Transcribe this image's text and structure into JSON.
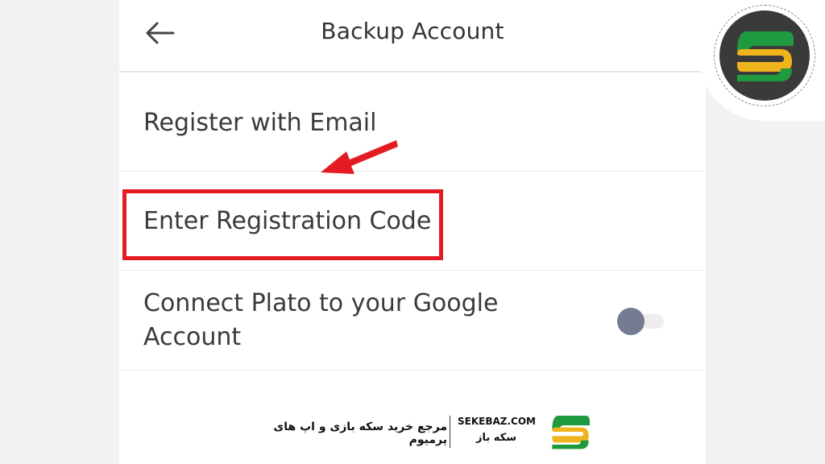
{
  "header": {
    "title": "Backup Account",
    "back_icon": "arrow-left-icon"
  },
  "options": [
    {
      "label": "Register with Email"
    },
    {
      "label": "Enter Registration Code"
    },
    {
      "label": "Connect Plato to your Google Account",
      "toggle_on": false
    }
  ],
  "annotation": {
    "color": "#e51b24"
  },
  "watermark": {
    "tagline": "مرجع خرید سکه بازی و اپ های پرمیوم",
    "domain": "SEKEBAZ.COM",
    "brand": "سکه باز",
    "logo_icon": "sekebaz-logo-icon",
    "logo_colors": {
      "green": "#1f9a3e",
      "yellow": "#f0b41c"
    }
  },
  "colors": {
    "toggle_knob": "#757b90",
    "text": "#3a3a3a"
  }
}
